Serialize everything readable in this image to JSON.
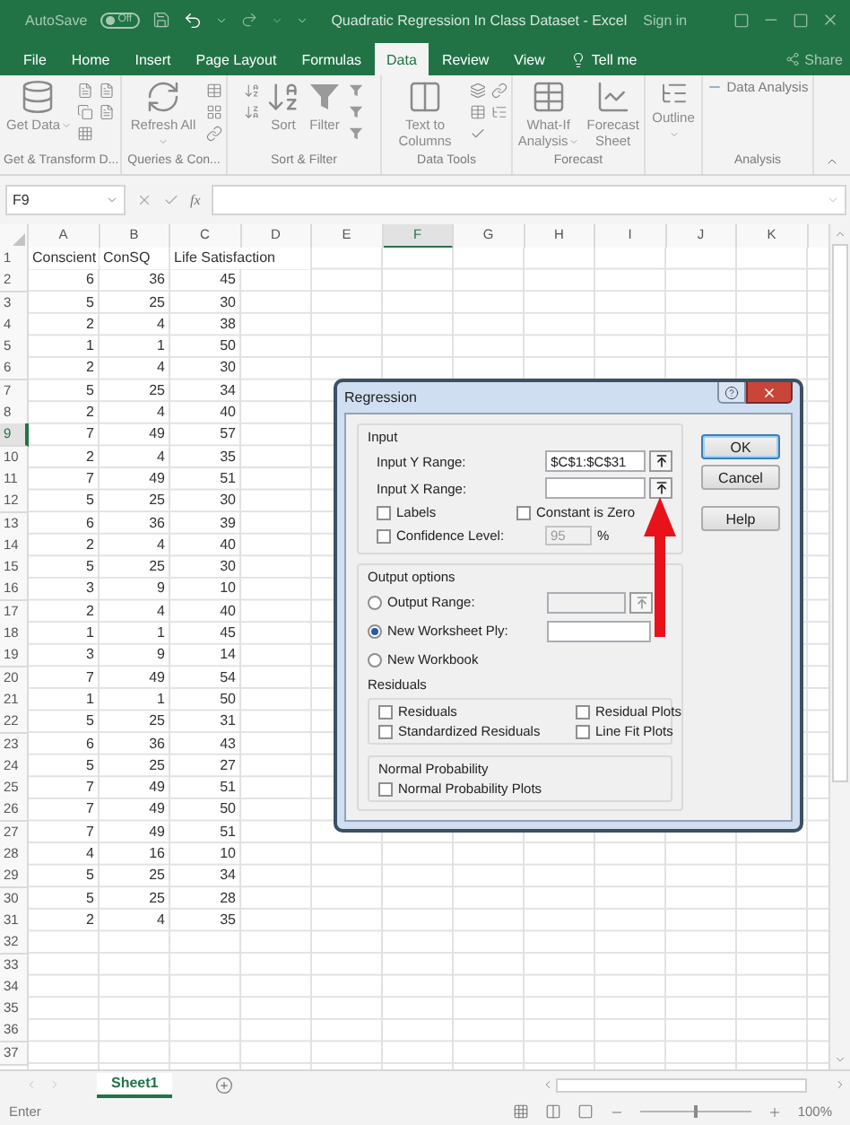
{
  "title_bar": {
    "autosave": {
      "label": "AutoSave",
      "on": false,
      "state_text": "Off"
    },
    "title": "Quadratic Regression In Class Dataset  -  Excel",
    "sign_in": "Sign in"
  },
  "tabs": [
    {
      "label": "File",
      "selected": false
    },
    {
      "label": "Home",
      "selected": false
    },
    {
      "label": "Insert",
      "selected": false
    },
    {
      "label": "Page Layout",
      "selected": false
    },
    {
      "label": "Formulas",
      "selected": false
    },
    {
      "label": "Data",
      "selected": true
    },
    {
      "label": "Review",
      "selected": false
    },
    {
      "label": "View",
      "selected": false
    }
  ],
  "tell_me": "Tell me",
  "share": "Share",
  "ribbon": [
    {
      "kind": "get",
      "label": "Get & Transform D...",
      "buttons": [
        {
          "label": "Get Data",
          "dropdown": true
        }
      ]
    },
    {
      "kind": "queries",
      "label": "Queries & Con...",
      "buttons": [
        {
          "label": "Refresh All",
          "dropdown": true
        }
      ]
    },
    {
      "kind": "sort",
      "label": "Sort & Filter",
      "buttons": [
        {
          "label": "Sort",
          "dropdown": false
        },
        {
          "label": "Filter",
          "dropdown": false
        }
      ]
    },
    {
      "kind": "tools",
      "label": "Data Tools",
      "buttons": [
        {
          "label": "Text to Columns",
          "dropdown": false
        }
      ]
    },
    {
      "kind": "forecast",
      "label": "Forecast",
      "buttons": [
        {
          "label": "What-If Analysis",
          "dropdown": true
        },
        {
          "label": "Forecast Sheet",
          "dropdown": false
        }
      ]
    },
    {
      "kind": "outline",
      "buttons": [
        {
          "label": "Outline",
          "dropdown": true
        }
      ]
    },
    {
      "kind": "analysis",
      "label": "Analysis",
      "buttons": [
        {
          "label": "Data Analysis"
        }
      ]
    }
  ],
  "formula_bar": {
    "name_box": "F9",
    "function_label": "fx"
  },
  "sheet": {
    "columns": [
      {
        "label": "A",
        "selected": false
      },
      {
        "label": "B",
        "selected": false
      },
      {
        "label": "C",
        "selected": false
      },
      {
        "label": "D",
        "selected": false
      },
      {
        "label": "E",
        "selected": false
      },
      {
        "label": "F",
        "selected": true
      },
      {
        "label": "G",
        "selected": false
      },
      {
        "label": "H",
        "selected": false
      },
      {
        "label": "I",
        "selected": false
      },
      {
        "label": "J",
        "selected": false
      },
      {
        "label": "K",
        "selected": false
      }
    ],
    "rows": [
      {
        "header": "1",
        "selected": false,
        "kind": "labels",
        "cells": [
          "Conscient",
          "ConSQ",
          "Life Satisfaction"
        ]
      },
      {
        "header": "2",
        "selected": false,
        "kind": "data",
        "cells": [
          "6",
          "36",
          "45"
        ]
      },
      {
        "header": "3",
        "selected": false,
        "kind": "data",
        "cells": [
          "5",
          "25",
          "30"
        ]
      },
      {
        "header": "4",
        "selected": false,
        "kind": "data",
        "cells": [
          "2",
          "4",
          "38"
        ]
      },
      {
        "header": "5",
        "selected": false,
        "kind": "data",
        "cells": [
          "1",
          "1",
          "50"
        ]
      },
      {
        "header": "6",
        "selected": false,
        "kind": "data",
        "cells": [
          "2",
          "4",
          "30"
        ]
      },
      {
        "header": "7",
        "selected": false,
        "kind": "data",
        "cells": [
          "5",
          "25",
          "34"
        ]
      },
      {
        "header": "8",
        "selected": false,
        "kind": "data",
        "cells": [
          "2",
          "4",
          "40"
        ]
      },
      {
        "header": "9",
        "selected": true,
        "kind": "data",
        "cells": [
          "7",
          "49",
          "57"
        ]
      },
      {
        "header": "10",
        "selected": false,
        "kind": "data",
        "cells": [
          "2",
          "4",
          "35"
        ]
      },
      {
        "header": "11",
        "selected": false,
        "kind": "data",
        "cells": [
          "7",
          "49",
          "51"
        ]
      },
      {
        "header": "12",
        "selected": false,
        "kind": "data",
        "cells": [
          "5",
          "25",
          "30"
        ]
      },
      {
        "header": "13",
        "selected": false,
        "kind": "data",
        "cells": [
          "6",
          "36",
          "39"
        ]
      },
      {
        "header": "14",
        "selected": false,
        "kind": "data",
        "cells": [
          "2",
          "4",
          "40"
        ]
      },
      {
        "header": "15",
        "selected": false,
        "kind": "data",
        "cells": [
          "5",
          "25",
          "30"
        ]
      },
      {
        "header": "16",
        "selected": false,
        "kind": "data",
        "cells": [
          "3",
          "9",
          "10"
        ]
      },
      {
        "header": "17",
        "selected": false,
        "kind": "data",
        "cells": [
          "2",
          "4",
          "40"
        ]
      },
      {
        "header": "18",
        "selected": false,
        "kind": "data",
        "cells": [
          "1",
          "1",
          "45"
        ]
      },
      {
        "header": "19",
        "selected": false,
        "kind": "data",
        "cells": [
          "3",
          "9",
          "14"
        ]
      },
      {
        "header": "20",
        "selected": false,
        "kind": "data",
        "cells": [
          "7",
          "49",
          "54"
        ]
      },
      {
        "header": "21",
        "selected": false,
        "kind": "data",
        "cells": [
          "1",
          "1",
          "50"
        ]
      },
      {
        "header": "22",
        "selected": false,
        "kind": "data",
        "cells": [
          "5",
          "25",
          "31"
        ]
      },
      {
        "header": "23",
        "selected": false,
        "kind": "data",
        "cells": [
          "6",
          "36",
          "43"
        ]
      },
      {
        "header": "24",
        "selected": false,
        "kind": "data",
        "cells": [
          "5",
          "25",
          "27"
        ]
      },
      {
        "header": "25",
        "selected": false,
        "kind": "data",
        "cells": [
          "7",
          "49",
          "51"
        ]
      },
      {
        "header": "26",
        "selected": false,
        "kind": "data",
        "cells": [
          "7",
          "49",
          "50"
        ]
      },
      {
        "header": "27",
        "selected": false,
        "kind": "data",
        "cells": [
          "7",
          "49",
          "51"
        ]
      },
      {
        "header": "28",
        "selected": false,
        "kind": "data",
        "cells": [
          "4",
          "16",
          "10"
        ]
      },
      {
        "header": "29",
        "selected": false,
        "kind": "data",
        "cells": [
          "5",
          "25",
          "34"
        ]
      },
      {
        "header": "30",
        "selected": false,
        "kind": "data",
        "cells": [
          "5",
          "25",
          "28"
        ]
      },
      {
        "header": "31",
        "selected": false,
        "kind": "data",
        "cells": [
          "2",
          "4",
          "35"
        ]
      },
      {
        "header": "32",
        "selected": false,
        "kind": "empty"
      },
      {
        "header": "33",
        "selected": false,
        "kind": "empty"
      },
      {
        "header": "34",
        "selected": false,
        "kind": "empty"
      },
      {
        "header": "35",
        "selected": false,
        "kind": "empty"
      },
      {
        "header": "36",
        "selected": false,
        "kind": "empty"
      },
      {
        "header": "37",
        "selected": false,
        "kind": "empty"
      }
    ]
  },
  "dialog": {
    "title": "Regression",
    "input": {
      "label": "Input",
      "ranges": [
        {
          "label": "Input Y Range:",
          "value": "$C$1:$C$31"
        },
        {
          "label": "Input X Range:"
        }
      ],
      "options": [
        {
          "label": "Labels",
          "checked": false
        },
        {
          "label": "Constant is Zero",
          "checked": false
        },
        {
          "label": "Confidence Level:",
          "checked": false
        }
      ],
      "confidence": {
        "value": "95",
        "unit": "%",
        "disabled": true
      }
    },
    "output": {
      "label": "Output options",
      "destinations": [
        {
          "label": "Output Range:",
          "selected": false,
          "field": {
            "disabled": true
          }
        },
        {
          "label": "New Worksheet Ply:",
          "selected": true,
          "field": {
            "disabled": false
          }
        },
        {
          "label": "New Workbook",
          "selected": false
        }
      ],
      "residuals": {
        "label": "Residuals",
        "options": [
          {
            "label": "Residuals",
            "checked": false
          },
          {
            "label": "Residual Plots",
            "checked": false
          },
          {
            "label": "Standardized Residuals",
            "checked": false
          },
          {
            "label": "Line Fit Plots",
            "checked": false
          }
        ]
      },
      "normal": {
        "label": "Normal Probability",
        "options": [
          {
            "label": "Normal Probability Plots",
            "checked": false
          }
        ]
      }
    },
    "buttons": [
      {
        "label": "OK",
        "default": true
      },
      {
        "label": "Cancel",
        "default": false
      },
      {
        "label": "Help",
        "default": false
      }
    ]
  },
  "sheet_tabs": [
    {
      "label": "Sheet1",
      "selected": true
    }
  ],
  "status_bar": {
    "mode": "Enter",
    "zoom": {
      "level": 0.5,
      "reading": "100%"
    }
  }
}
